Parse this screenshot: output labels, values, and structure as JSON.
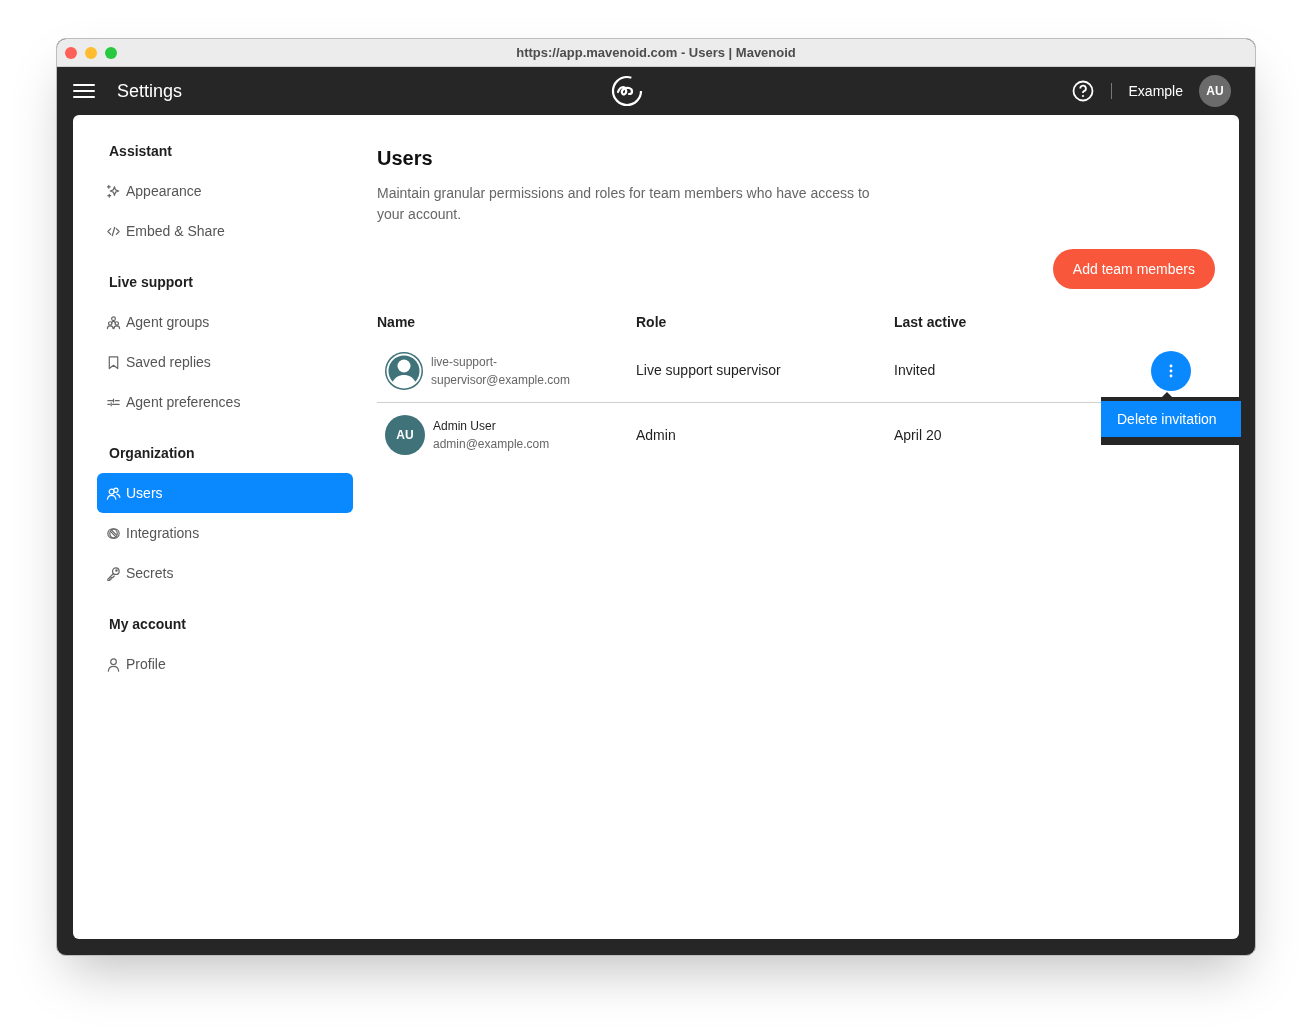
{
  "window": {
    "title": "https://app.mavenoid.com - Users | Mavenoid"
  },
  "header": {
    "title": "Settings",
    "account": "Example",
    "avatar": "AU"
  },
  "sidebar": {
    "sections": [
      {
        "title": "Assistant",
        "items": [
          {
            "label": "Appearance",
            "selected": false
          },
          {
            "label": "Embed & Share",
            "selected": false
          }
        ]
      },
      {
        "title": "Live support",
        "items": [
          {
            "label": "Agent groups",
            "selected": false
          },
          {
            "label": "Saved replies",
            "selected": false
          },
          {
            "label": "Agent preferences",
            "selected": false
          }
        ]
      },
      {
        "title": "Organization",
        "items": [
          {
            "label": "Users",
            "selected": true
          },
          {
            "label": "Integrations",
            "selected": false
          },
          {
            "label": "Secrets",
            "selected": false
          }
        ]
      },
      {
        "title": "My account",
        "items": [
          {
            "label": "Profile",
            "selected": false
          }
        ]
      }
    ]
  },
  "page": {
    "title": "Users",
    "description": "Maintain granular permissions and roles for team members who have access to your account.",
    "action": "Add team members"
  },
  "table": {
    "columns": [
      "Name",
      "Role",
      "Last active"
    ],
    "rows": [
      {
        "kind": "invited",
        "name_lines": [
          "live-support-",
          "supervisor@example.com"
        ],
        "role": "Live support supervisor",
        "last_active": "Invited",
        "menu_open": true,
        "menu": [
          "Delete invitation"
        ]
      },
      {
        "kind": "member",
        "avatar": "AU",
        "name": "Admin User",
        "email": "admin@example.com",
        "role": "Admin",
        "last_active": "April 20",
        "menu_open": false
      }
    ]
  }
}
